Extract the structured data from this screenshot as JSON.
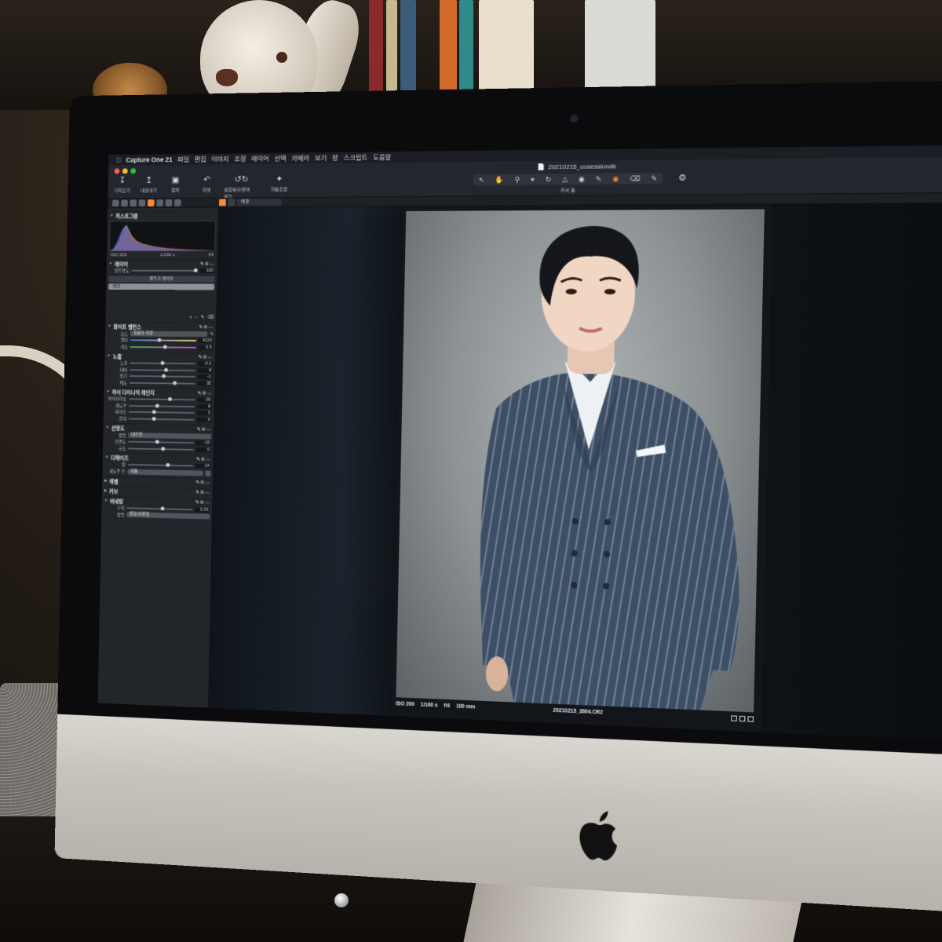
{
  "menubar": {
    "app_name": "Capture One 21",
    "items": [
      "파일",
      "편집",
      "이미지",
      "조정",
      "레이어",
      "선택",
      "카메라",
      "보기",
      "창",
      "스크립트",
      "도움말"
    ]
  },
  "titlebar": {
    "document": "20210215_cosessiondb"
  },
  "toolbar": {
    "left_buttons": [
      "가져오기",
      "내보내기",
      "캡처",
      "리셋",
      "설정복사/붙여넣기",
      "자동조정"
    ],
    "cursor_tools_label": "커서 툴"
  },
  "viewer_bar": {
    "background_select": "배경",
    "fit_label": "맞춤"
  },
  "panel": {
    "histogram": {
      "title": "히스토그램",
      "iso": "ISO 200",
      "shutter": "1/160 s",
      "aperture": "f/4"
    },
    "layers": {
      "title": "레이어",
      "opacity_label": "불투명도",
      "opacity_value": "100",
      "fill_layer_button": "채우기 레이어",
      "background_layer": "배경"
    },
    "white_balance": {
      "title": "화이트 밸런스",
      "mode_label": "모드",
      "mode_value": "사용자 지정",
      "kelvin_label": "켈빈",
      "kelvin_value": "4120",
      "tint_label": "색조",
      "tint_value": "0.5"
    },
    "exposure": {
      "title": "노출",
      "rows": [
        {
          "label": "노출",
          "value": "-0.2"
        },
        {
          "label": "대비",
          "value": "8"
        },
        {
          "label": "밝기",
          "value": "-1"
        },
        {
          "label": "채도",
          "value": "35"
        }
      ]
    },
    "hdr": {
      "title": "하이 다이나믹 레인지",
      "rows": [
        {
          "label": "하이라이트",
          "value": "-20"
        },
        {
          "label": "섀도우",
          "value": "8"
        },
        {
          "label": "화이트",
          "value": "0"
        },
        {
          "label": "블랙",
          "value": "0"
        }
      ]
    },
    "clarity": {
      "title": "선명도",
      "method_label": "방법",
      "method_value": "내추럴",
      "rows": [
        {
          "label": "선명도",
          "value": "-15"
        },
        {
          "label": "구조",
          "value": "0"
        }
      ]
    },
    "dehaze": {
      "title": "디헤이즈",
      "amount_label": "양",
      "amount_value": "14",
      "color_label": "섀도우 톤",
      "color_value": "자동"
    },
    "collapsed": [
      "레벨",
      "커브"
    ],
    "vignetting": {
      "title": "비네팅",
      "amount_label": "수치",
      "amount_value": "0.25",
      "method_label": "방법",
      "method_value": "원형 타원형"
    }
  },
  "photo": {
    "iso": "ISO 200",
    "shutter": "1/160 s",
    "aperture": "f/4",
    "focal": "100 mm",
    "filename": "20210215_3604.CR2"
  },
  "colors": {
    "accent": "#ff8a3a",
    "panel_bg": "#22262b",
    "suit": "#3d4f66"
  }
}
